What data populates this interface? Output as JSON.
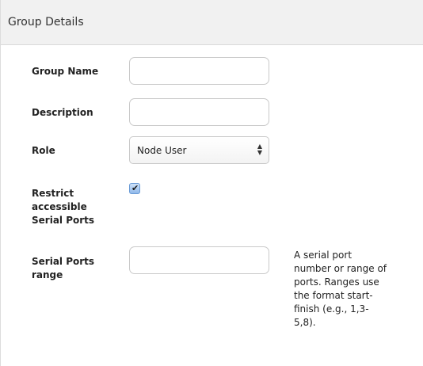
{
  "panel": {
    "title": "Group Details"
  },
  "form": {
    "group_name": {
      "label": "Group Name",
      "value": "",
      "placeholder": ""
    },
    "description": {
      "label": "Description",
      "value": "",
      "placeholder": ""
    },
    "role": {
      "label": "Role",
      "selected": "Node User"
    },
    "restrict_serial": {
      "label_line1": "Restrict",
      "label_line2": "accessible",
      "label_line3": "Serial Ports",
      "checked": true
    },
    "serial_range": {
      "label_line1": "Serial Ports",
      "label_line2": "range",
      "value": "",
      "help_line1": "A serial port",
      "help_line2": "number or range of",
      "help_line3": "ports. Ranges use",
      "help_line4": "the format start-",
      "help_line5": "finish (e.g., 1,3-",
      "help_line6": "5,8)."
    }
  },
  "icons": {
    "select_arrows": "updown-chevron-icon",
    "checkbox": "checkmark-icon"
  },
  "colors": {
    "header_bg": "#f1f1f1",
    "checkbox_accent": "#8fb8ea"
  }
}
